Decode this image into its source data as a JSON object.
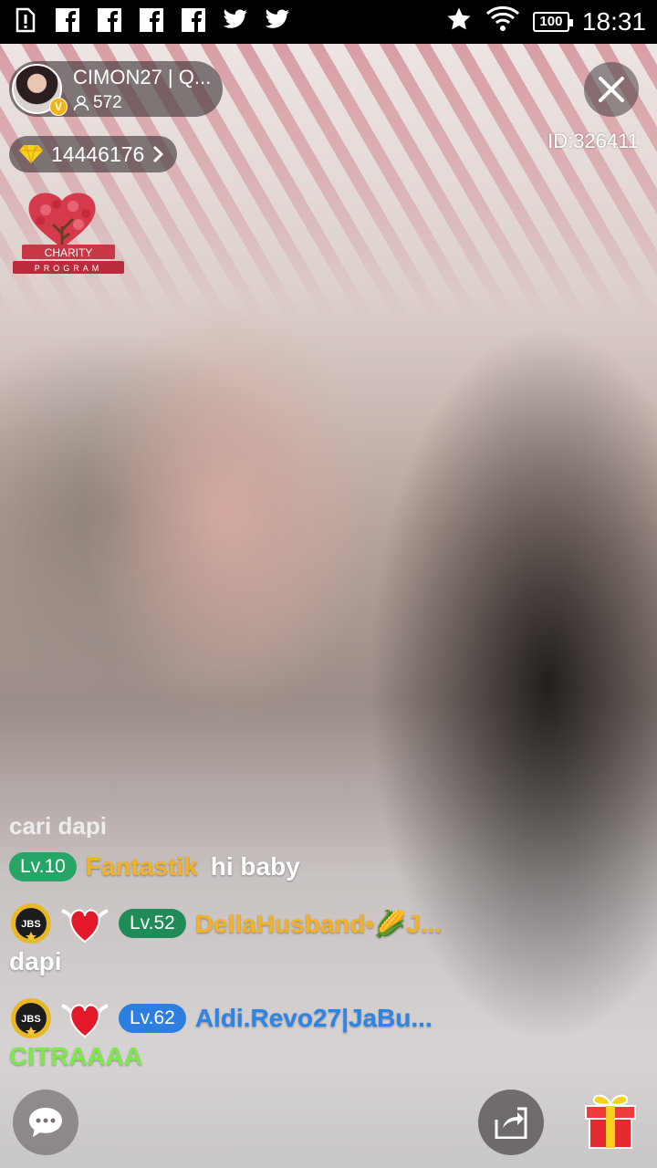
{
  "status_bar": {
    "time": "18:31",
    "battery": "100",
    "left_icons": [
      "alert-icon",
      "facebook-icon",
      "facebook-icon",
      "facebook-icon",
      "facebook-icon",
      "twitter-icon",
      "twitter-icon"
    ],
    "right_icons": [
      "star-icon",
      "wifi-icon",
      "battery-icon"
    ]
  },
  "host": {
    "name": "CIMON27 | Q...",
    "viewers": "572",
    "verified_badge": "V"
  },
  "room_id": "ID:326411",
  "diamonds": "14446176",
  "charity": {
    "line1": "CHARITY",
    "line2": "PROGRAM"
  },
  "chat": {
    "faded_line": "cari dapi",
    "messages": [
      {
        "level": "Lv.10",
        "user": "Fantastik",
        "text": "hi baby",
        "level_color": "#27a567"
      },
      {
        "badge": "JBS",
        "level": "Lv.52",
        "user": "DellaHusband•🌽J...",
        "text": "dapi",
        "level_color": "#1f8b56"
      },
      {
        "badge": "JBS",
        "level": "Lv.62",
        "user": "Aldi.Revo27|JaBu...",
        "text": "CITRAAAA",
        "level_color": "#2c7fe0",
        "text_color": "#7ee84a"
      }
    ]
  },
  "colors": {
    "username_gold": "#f2b228",
    "username_blue": "#2b84e8",
    "accent_green": "#7ee84a"
  }
}
